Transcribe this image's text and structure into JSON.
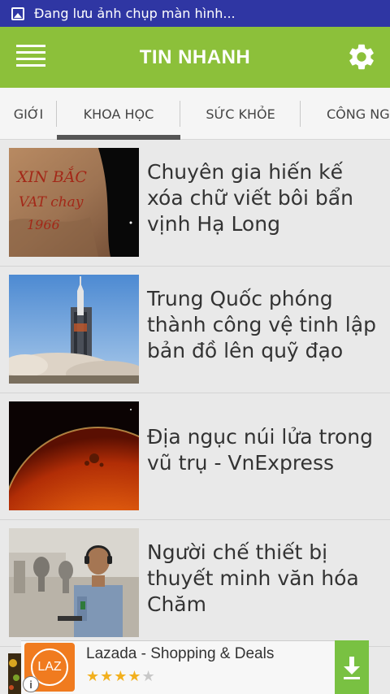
{
  "status_bar": {
    "notification_text": "Đang lưu ảnh chụp màn hình...",
    "icon": "image-icon"
  },
  "app_bar": {
    "title": "TIN NHANH",
    "menu_icon": "hamburger-menu-icon",
    "settings_icon": "gear-icon",
    "color": "#8cc03a"
  },
  "tabs": [
    {
      "label": "GIỚI",
      "active": false
    },
    {
      "label": "KHOA HỌC",
      "active": true
    },
    {
      "label": "SỨC KHỎE",
      "active": false
    },
    {
      "label": "CÔNG NG",
      "active": false
    }
  ],
  "articles": [
    {
      "title": "Chuyên gia hiến kế xóa chữ viết bôi bẩn vịnh Hạ Long",
      "thumbnail": "graffiti-rock-image",
      "graffiti_lines": [
        "XIN BẮC",
        "VAT chay",
        "1966"
      ]
    },
    {
      "title": "Trung Quốc phóng thành công vệ tinh lập bản đồ lên quỹ đạo",
      "thumbnail": "rocket-launch-image"
    },
    {
      "title": "Địa ngục núi lửa trong vũ trụ - VnExpress",
      "thumbnail": "fiery-planet-image"
    },
    {
      "title": "Người chế thiết bị thuyết minh văn hóa Chăm",
      "thumbnail": "man-with-headphones-image"
    }
  ],
  "ad_banner": {
    "app_name": "Lazada - Shopping & Deals",
    "logo_text": "LAZ",
    "rating_stars": 4.5,
    "download_icon": "download-icon",
    "info_icon": "info-icon",
    "brand_color": "#f07b1f",
    "button_color": "#79c142"
  }
}
